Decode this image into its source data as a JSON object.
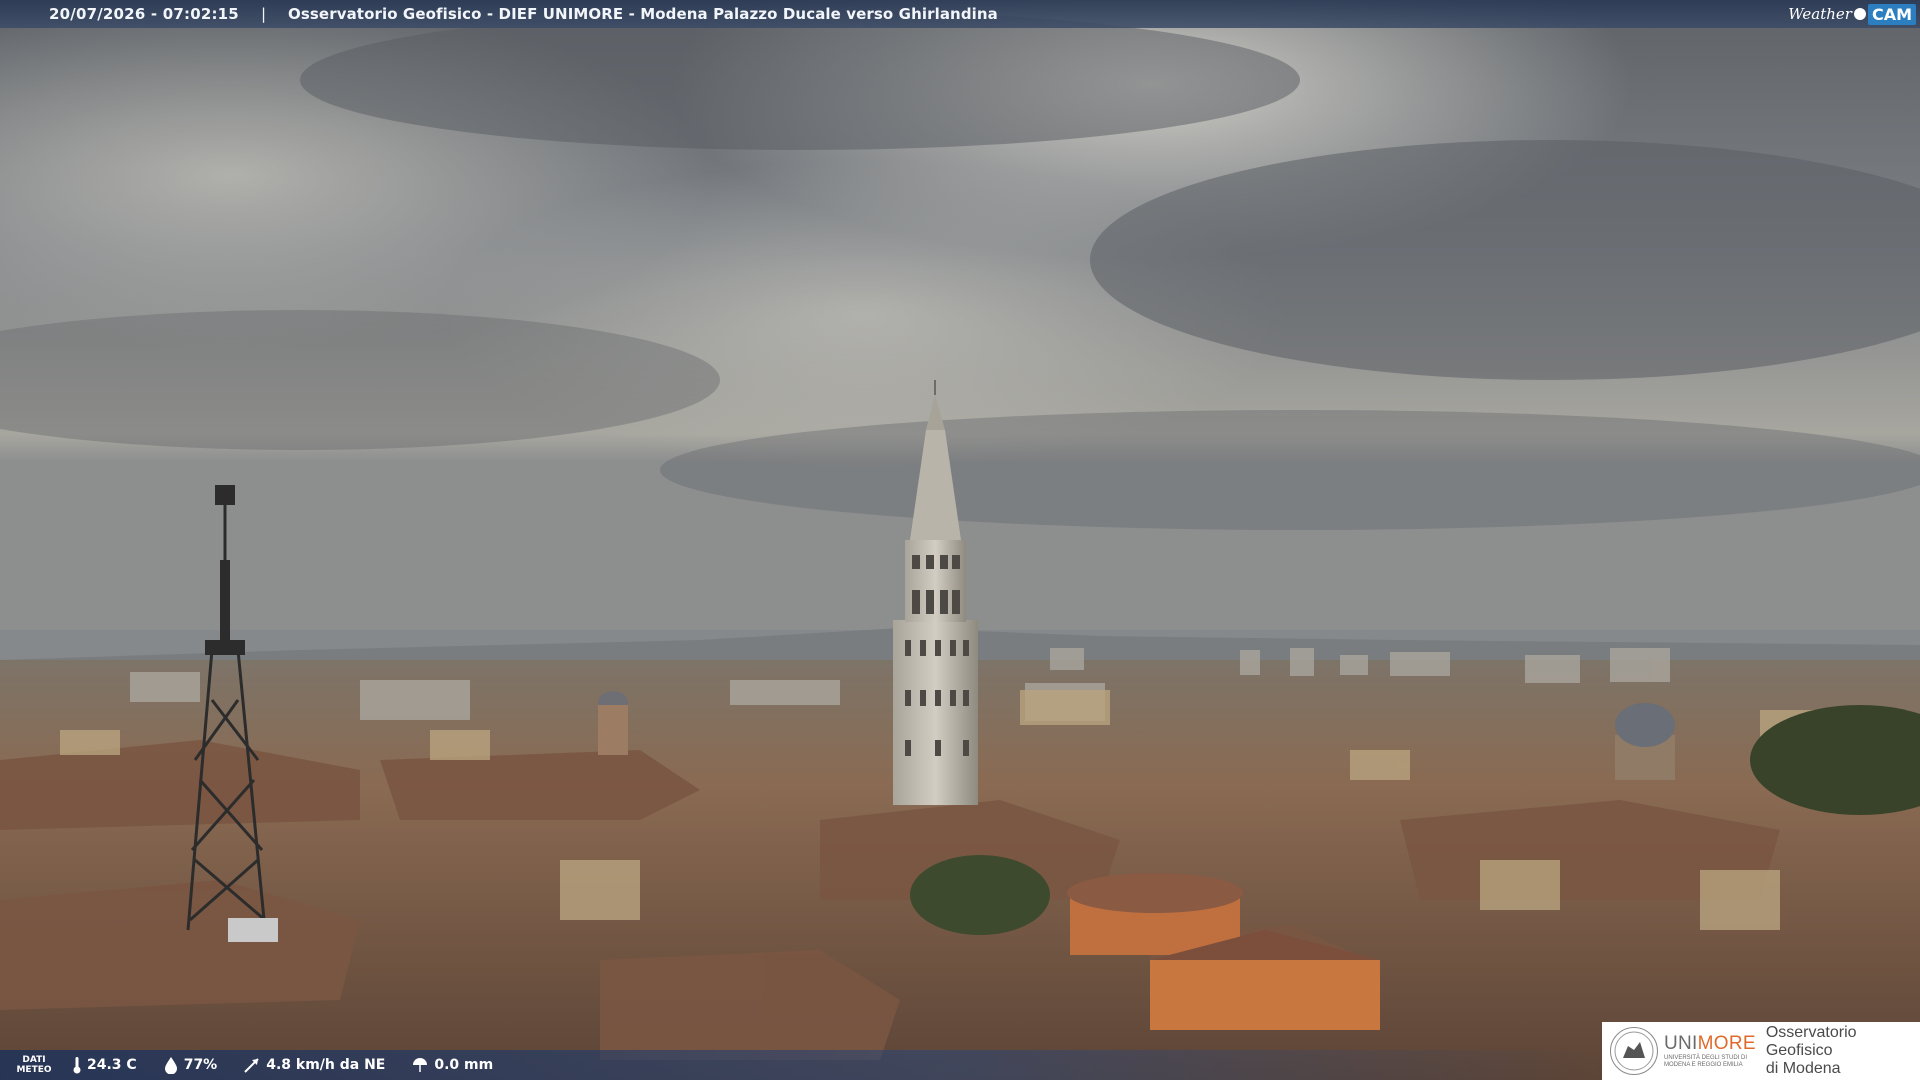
{
  "header": {
    "timestamp": "20/07/2026 - 07:02:15",
    "separator": "|",
    "title": "Osservatorio Geofisico - DIEF UNIMORE - Modena Palazzo Ducale verso Ghirlandina"
  },
  "logo_weathercam": {
    "word": "Weather",
    "cam": "CAM"
  },
  "weather_data": {
    "label_line1": "DATI",
    "label_line2": "METEO",
    "temperature": "24.3 C",
    "humidity": "77%",
    "wind": "4.8 km/h da NE",
    "rain": "0.0 mm"
  },
  "institution": {
    "brand_uni": "UNI",
    "brand_more": "MORE",
    "brand_sub1": "UNIVERSITÀ DEGLI STUDI DI",
    "brand_sub2": "MODENA E REGGIO EMILIA",
    "observatory_line1": "Osservatorio Geofisico",
    "observatory_line2": "di Modena"
  },
  "colors": {
    "header_bg": "#2f4262",
    "unimore_orange": "#e06a2c",
    "cam_blue": "#2b7fc0"
  }
}
